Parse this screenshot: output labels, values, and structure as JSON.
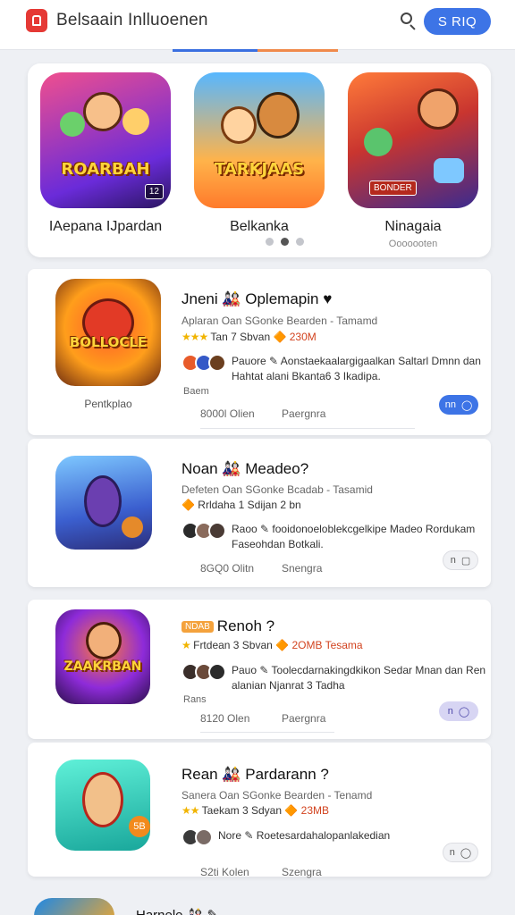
{
  "header": {
    "app_title": "Belsaain Inlluoenen",
    "action_label": "S RIQ",
    "search_icon": "search-icon",
    "logo_icon": "app-logo-icon"
  },
  "featured": {
    "items": [
      {
        "title": "IAepana IJpardan",
        "subtitle": "",
        "art_text": "ROARBAH",
        "art_badge": "12",
        "colors": [
          "#f05a8a",
          "#6a2bd9"
        ]
      },
      {
        "title": "Belkanka",
        "subtitle": "",
        "art_text": "TARKJAAS",
        "art_badge": "",
        "colors": [
          "#4fb3ff",
          "#ff8a2b"
        ]
      },
      {
        "title": "Ninagaia",
        "subtitle": "Ooooooten",
        "art_text": "",
        "art_badge": "BONDER",
        "colors": [
          "#ff6d3a",
          "#3b2a8f"
        ]
      }
    ],
    "active_page": 2,
    "page_count": 3
  },
  "games": [
    {
      "title": "Jneni 🎎 Oplemapin ♥",
      "meta": "Aplaran Oan SGonke Bearden - Tamamd",
      "rating_stars": "★★★",
      "rating_text": "Tan 7 Sbvan",
      "price": "🔶 230M",
      "avatar_colors": [
        "#e85b2a",
        "#3559c7",
        "#6b3f1f"
      ],
      "desc_prefix": "Pauore ✎",
      "desc": "Aonstaekaalargigaalkan Saltarl Dmnn dan Hahtat alani Bkanta6 3 Ikadipa.",
      "side_note": "Baem",
      "caption": "Pentkplao",
      "foot_left": "8000l Olien",
      "foot_right": "Paergnra",
      "action_label": "nn",
      "art_text": "BOLLOCLE",
      "colors": [
        "#ff9e1b",
        "#d7261e"
      ]
    },
    {
      "title": "Noan 🎎 Meadeo?",
      "meta": "Defeten Oan SGonke Bcadab - Tasamid",
      "rating_stars": "",
      "rating_text": "🔶 Rrldaha 1 Sdijan 2 bn",
      "price": "",
      "avatar_colors": [
        "#2b2b2b",
        "#8a6b5c",
        "#4a3b35"
      ],
      "desc_prefix": "Raoo ✎",
      "desc": "fooidonoeloblekcgelkipe Madeo Rordukam Faseohdan Botkali.",
      "side_note": "",
      "caption": "",
      "foot_left": "8GQ0 Olitn",
      "foot_right": "Snengra",
      "action_label": "n",
      "art_text": "",
      "colors": [
        "#5aa9ff",
        "#2c3e9e"
      ]
    },
    {
      "title": "Renoh ?",
      "tag": "NDAB",
      "meta": "",
      "rating_stars": "★",
      "rating_text": "Frtdean 3 Sbvan",
      "price": "🔶 2OMB Tesama",
      "avatar_colors": [
        "#3a2e2a",
        "#6b4a3a",
        "#2b2b2b"
      ],
      "desc_prefix": "Pauo ✎",
      "desc": "Toolecdarnakingdkikon Sedar Mnan dan Ren alanian Njanrat 3 Tadha",
      "side_note": "Rans",
      "caption": "",
      "foot_left": "8120 Olen",
      "foot_right": "Paergnra",
      "action_label": "n",
      "art_text": "ZAAKRBAN",
      "colors": [
        "#8e2bd9",
        "#ff7a1a"
      ]
    },
    {
      "title": "Rean 🎎 Pardarann ?",
      "meta": "Sanera Oan SGonke Bearden - Tenamd",
      "rating_stars": "★★",
      "rating_text": "Taekam 3 Sdyan",
      "price": "🔶 23MB",
      "avatar_colors": [
        "#3a3a3a",
        "#7a6b66"
      ],
      "desc_prefix": "Nore ✎",
      "desc": "Roetesardahalopanlakedian",
      "side_note": "",
      "caption": "",
      "foot_left": "S2ti Kolen",
      "foot_right": "Szengra",
      "action_label": "n",
      "level_badge": "5B",
      "art_text": "",
      "colors": [
        "#3fe0c8",
        "#19a79b"
      ]
    }
  ],
  "bottom_peek": {
    "title": "Harnele 🎎 ✎"
  },
  "colors": {
    "accent": "#3d74e6",
    "accent_orange": "#f08a4b",
    "price": "#d2431f",
    "star": "#f1b400"
  }
}
